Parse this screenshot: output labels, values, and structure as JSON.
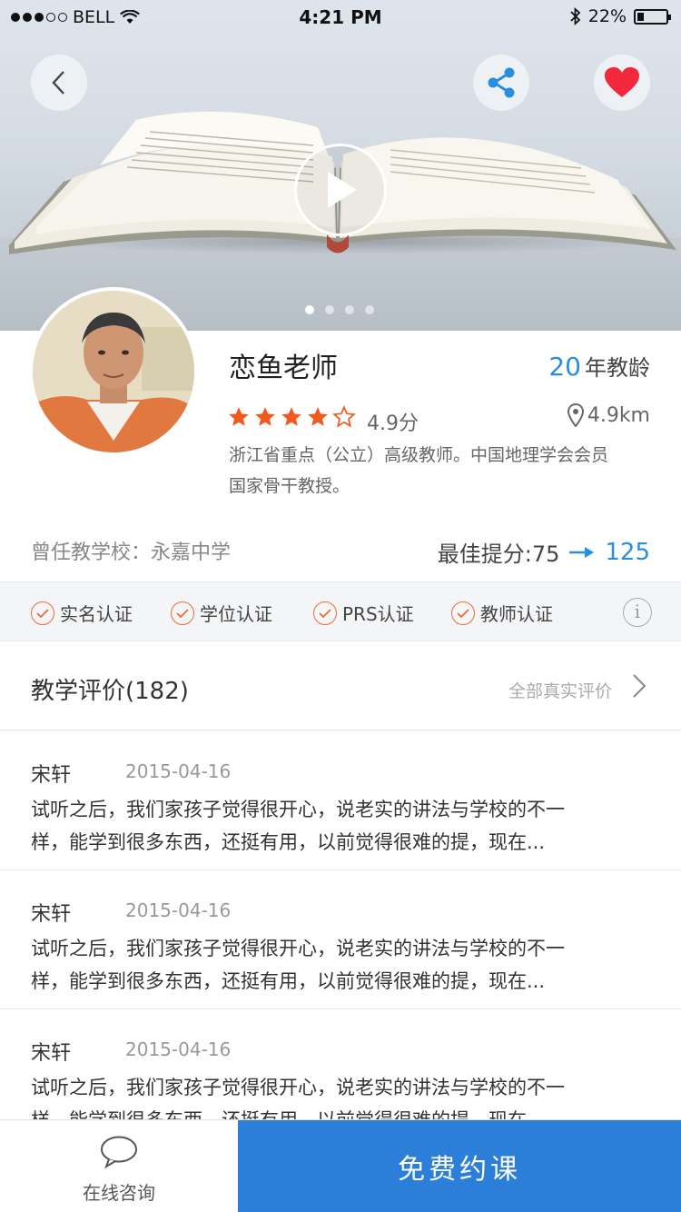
{
  "status_bar": {
    "carrier": "BELL",
    "time": "4:21 PM",
    "battery": "22%",
    "battery_level": 0.22
  },
  "hero": {
    "carousel_total": 4,
    "carousel_active": 1
  },
  "teacher": {
    "name": "恋鱼老师",
    "years": "20",
    "years_unit": "年教龄",
    "stars": 4.5,
    "rating": "4.9分",
    "distance": "4.9km",
    "description_line1": "浙江省重点（公立）高级教师。中国地理学会会员",
    "description_line2": "国家骨干教授。",
    "school": "曾任教学校：永嘉中学",
    "score_label": "最佳提分:",
    "score_from": "75",
    "score_to": "125"
  },
  "certifications": [
    "实名认证",
    "学位认证",
    "PRS认证",
    "教师认证"
  ],
  "reviews_section": {
    "title": "教学评价(182)",
    "all_link": "全部真实评价"
  },
  "reviews": [
    {
      "author": "宋轩",
      "date": "2015-04-16",
      "line1": "试听之后，我们家孩子觉得很开心，说老实的讲法与学校的不一",
      "line2": "样，能学到很多东西，还挺有用，以前觉得很难的提，现在..."
    },
    {
      "author": "宋轩",
      "date": "2015-04-16",
      "line1": "试听之后，我们家孩子觉得很开心，说老实的讲法与学校的不一",
      "line2": "样，能学到很多东西，还挺有用，以前觉得很难的提，现在..."
    },
    {
      "author": "宋轩",
      "date": "2015-04-16",
      "line1": "试听之后，我们家孩子觉得很开心，说老实的讲法与学校的不一",
      "line2": "样，能学到很多东西，还挺有用，以前觉得很难的提，现在..."
    }
  ],
  "bottom_bar": {
    "consult_label": "在线咨询",
    "book_label": "免费约课"
  },
  "colors": {
    "accent_blue": "#2a8ee0",
    "button_blue": "#2b7fd8",
    "star_orange": "#f05a1e",
    "heart_red": "#f2283c"
  }
}
